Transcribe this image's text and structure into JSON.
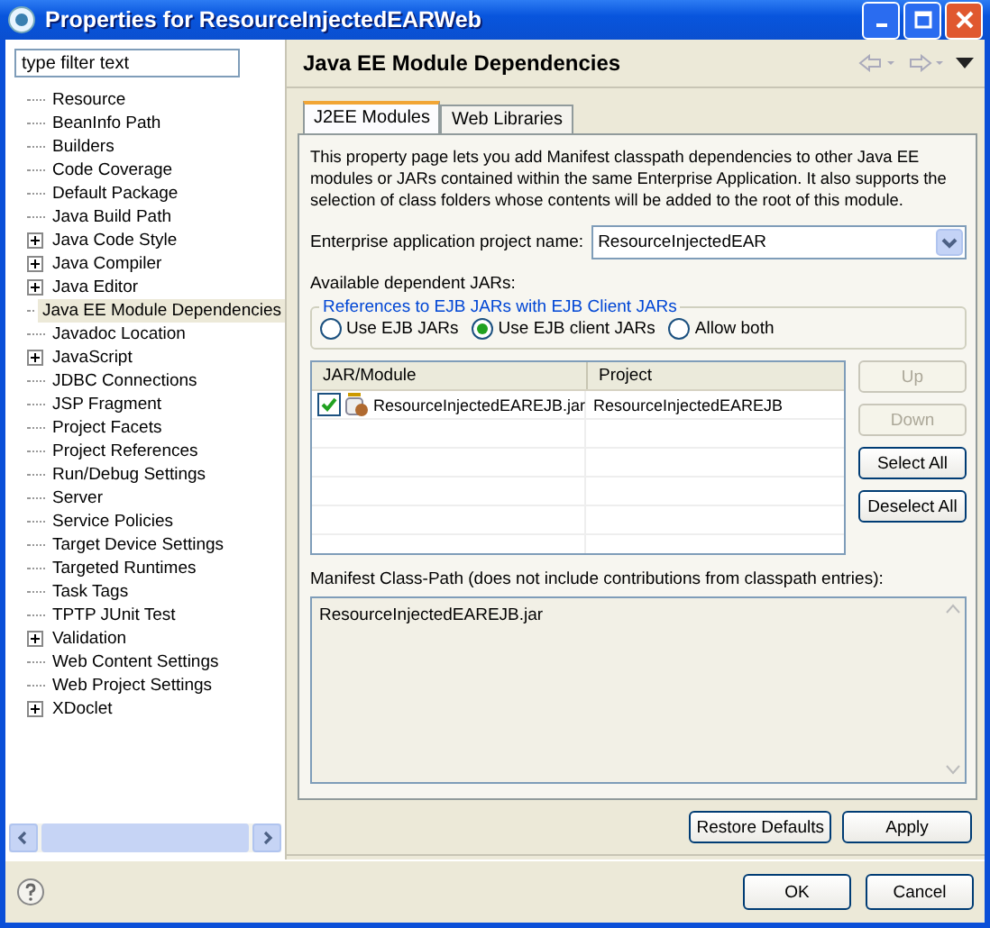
{
  "window": {
    "title": "Properties for ResourceInjectedEARWeb"
  },
  "filter": {
    "placeholder": "type filter text"
  },
  "tree": [
    {
      "label": "Resource",
      "kind": "leaf",
      "selected": false
    },
    {
      "label": "BeanInfo Path",
      "kind": "leaf",
      "selected": false
    },
    {
      "label": "Builders",
      "kind": "leaf",
      "selected": false
    },
    {
      "label": "Code Coverage",
      "kind": "leaf",
      "selected": false
    },
    {
      "label": "Default Package",
      "kind": "leaf",
      "selected": false
    },
    {
      "label": "Java Build Path",
      "kind": "leaf",
      "selected": false
    },
    {
      "label": "Java Code Style",
      "kind": "group",
      "selected": false
    },
    {
      "label": "Java Compiler",
      "kind": "group",
      "selected": false
    },
    {
      "label": "Java Editor",
      "kind": "group",
      "selected": false
    },
    {
      "label": "Java EE Module Dependencies",
      "kind": "leaf",
      "selected": true
    },
    {
      "label": "Javadoc Location",
      "kind": "leaf",
      "selected": false
    },
    {
      "label": "JavaScript",
      "kind": "group",
      "selected": false
    },
    {
      "label": "JDBC Connections",
      "kind": "leaf",
      "selected": false
    },
    {
      "label": "JSP Fragment",
      "kind": "leaf",
      "selected": false
    },
    {
      "label": "Project Facets",
      "kind": "leaf",
      "selected": false
    },
    {
      "label": "Project References",
      "kind": "leaf",
      "selected": false
    },
    {
      "label": "Run/Debug Settings",
      "kind": "leaf",
      "selected": false
    },
    {
      "label": "Server",
      "kind": "leaf",
      "selected": false
    },
    {
      "label": "Service Policies",
      "kind": "leaf",
      "selected": false
    },
    {
      "label": "Target Device Settings",
      "kind": "leaf",
      "selected": false
    },
    {
      "label": "Targeted Runtimes",
      "kind": "leaf",
      "selected": false
    },
    {
      "label": "Task Tags",
      "kind": "leaf",
      "selected": false
    },
    {
      "label": "TPTP JUnit Test",
      "kind": "leaf",
      "selected": false
    },
    {
      "label": "Validation",
      "kind": "group",
      "selected": false
    },
    {
      "label": "Web Content Settings",
      "kind": "leaf",
      "selected": false
    },
    {
      "label": "Web Project Settings",
      "kind": "leaf",
      "selected": false
    },
    {
      "label": "XDoclet",
      "kind": "group",
      "selected": false
    }
  ],
  "page": {
    "title": "Java EE Module Dependencies"
  },
  "tabs": [
    {
      "label": "J2EE Modules",
      "selected": true
    },
    {
      "label": "Web Libraries",
      "selected": false
    }
  ],
  "description": "This property page lets you add Manifest classpath dependencies to other Java EE modules or JARs contained within the same Enterprise Application. It also supports the selection of class folders whose contents will be added to the root of this module.",
  "project_field": {
    "label": "Enterprise application project name:",
    "value": "ResourceInjectedEAR"
  },
  "jars_label": "Available dependent JARs:",
  "references": {
    "title": "References to EJB JARs with EJB Client JARs",
    "options": [
      {
        "label": "Use EJB JARs",
        "selected": false
      },
      {
        "label": "Use EJB client JARs",
        "selected": true
      },
      {
        "label": "Allow both",
        "selected": false
      }
    ]
  },
  "table": {
    "columns": [
      "JAR/Module",
      "Project"
    ],
    "rows": [
      {
        "checked": true,
        "jar": "ResourceInjectedEAREJB.jar",
        "project": "ResourceInjectedEAREJB"
      }
    ]
  },
  "side_buttons": [
    {
      "label": "Up",
      "disabled": true
    },
    {
      "label": "Down",
      "disabled": true
    },
    {
      "label": "Select All",
      "disabled": false
    },
    {
      "label": "Deselect All",
      "disabled": false
    }
  ],
  "manifest": {
    "label": "Manifest Class-Path (does not include contributions from classpath entries):",
    "value": "ResourceInjectedEAREJB.jar"
  },
  "page_buttons": [
    "Restore Defaults",
    "Apply"
  ],
  "dialog_buttons": [
    "OK",
    "Cancel"
  ]
}
